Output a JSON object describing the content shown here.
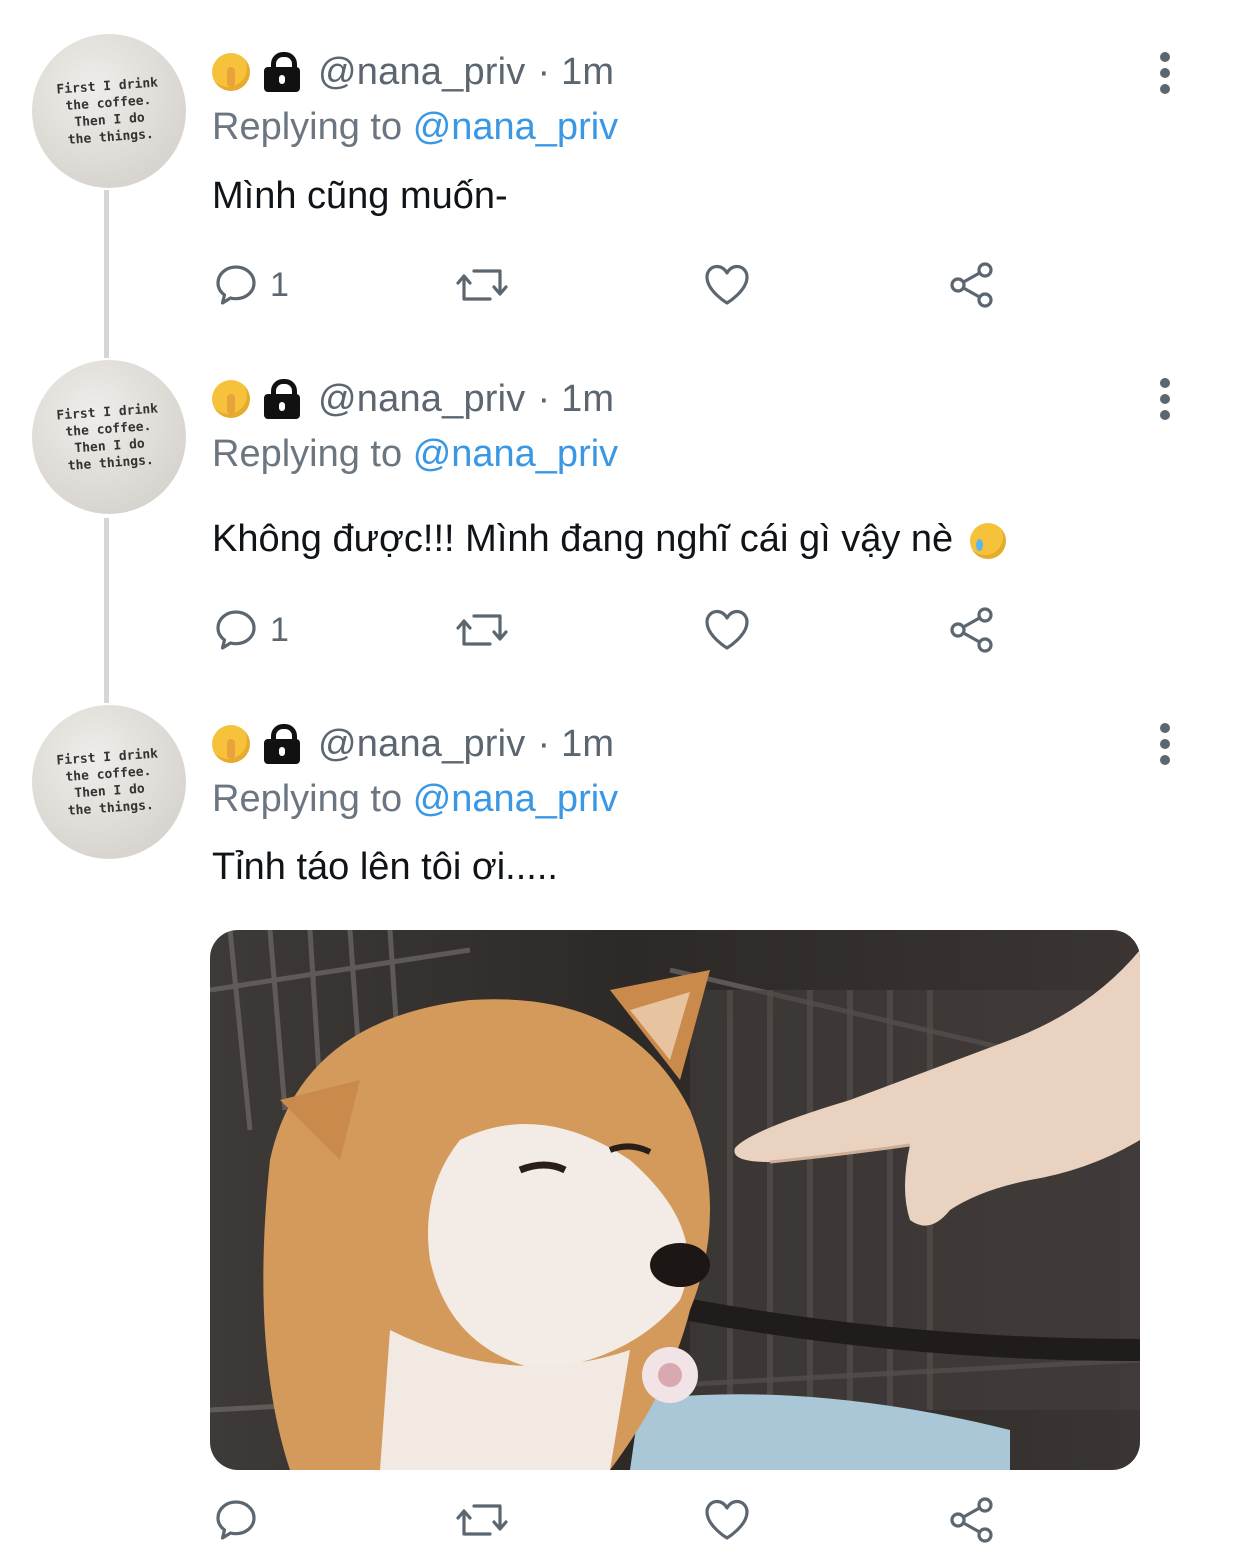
{
  "tweets": [
    {
      "avatar_text": "First I drink\nthe coffee.\nThen I do\nthe things.",
      "handle": "@nana_priv",
      "time": "· 1m",
      "replying_prefix": "Replying to",
      "replying_to": "@nana_priv",
      "text": "Mình cũng muốn-",
      "reply_count": "1"
    },
    {
      "avatar_text": "First I drink\nthe coffee.\nThen I do\nthe things.",
      "handle": "@nana_priv",
      "time": "· 1m",
      "replying_prefix": "Replying to",
      "replying_to": "@nana_priv",
      "text": "Không được!!! Mình đang nghĩ cái gì vậy nè",
      "reply_count": "1"
    },
    {
      "avatar_text": "First I drink\nthe coffee.\nThen I do\nthe things.",
      "handle": "@nana_priv",
      "time": "· 1m",
      "replying_prefix": "Replying to",
      "replying_to": "@nana_priv",
      "text": "Tỉnh táo lên tôi ơi.....",
      "reply_count": ""
    }
  ],
  "icons": {
    "status_emoji": "shushing-face-icon",
    "lock": "lock-icon",
    "more": "more-vertical-icon",
    "reply": "reply-icon",
    "retweet": "retweet-icon",
    "like": "heart-icon",
    "share": "share-icon",
    "text_emoji": "crying-face-icon"
  },
  "colors": {
    "mention": "#3a97e4",
    "muted": "#5b6670",
    "text": "#0f1419",
    "thread_line": "#d6d6d6"
  }
}
